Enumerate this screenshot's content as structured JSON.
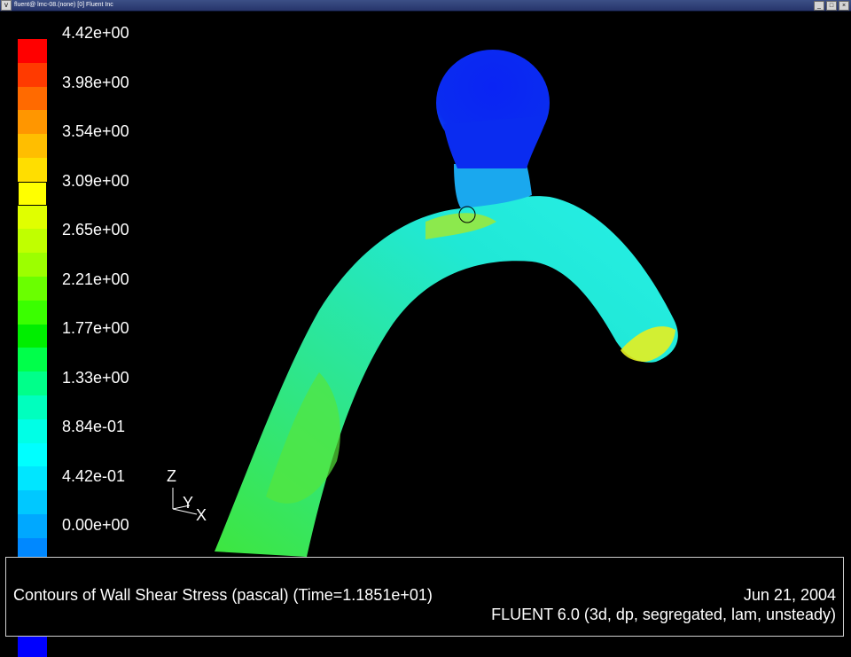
{
  "window": {
    "title": "fluent@ lmc-08.(none) [0] Fluent Inc",
    "menu_glyph": "v",
    "minimize_glyph": "_",
    "maximize_glyph": "□",
    "close_glyph": "×"
  },
  "legend": {
    "labels": [
      "4.42e+00",
      "3.98e+00",
      "3.54e+00",
      "3.09e+00",
      "2.65e+00",
      "2.21e+00",
      "1.77e+00",
      "1.33e+00",
      "8.84e-01",
      "4.42e-01",
      "0.00e+00"
    ],
    "colors": [
      "#ff0000",
      "#ff3a00",
      "#ff6a00",
      "#ff9600",
      "#ffbe00",
      "#ffde00",
      "#ffff00",
      "#e0ff00",
      "#c0ff00",
      "#9cff00",
      "#6aff00",
      "#3aff00",
      "#00ee00",
      "#00ff4a",
      "#00ff8a",
      "#00ffbe",
      "#00ffe6",
      "#00ffff",
      "#00e6ff",
      "#00c8ff",
      "#00a8ff",
      "#0088ff",
      "#0060ff",
      "#0040ff",
      "#0018ff",
      "#0000ff"
    ]
  },
  "axes": {
    "z": "Z",
    "y": "Y",
    "x": "X"
  },
  "footer": {
    "caption": "Contours of Wall Shear Stress (pascal)  (Time=1.1851e+01)",
    "date": "Jun 21, 2004",
    "version": "FLUENT 6.0 (3d, dp, segregated, lam, unsteady)"
  },
  "colors": {
    "aneurysm": "#0a2cf0",
    "vessel": "#24e6c8",
    "highlight": "#9be62a"
  }
}
